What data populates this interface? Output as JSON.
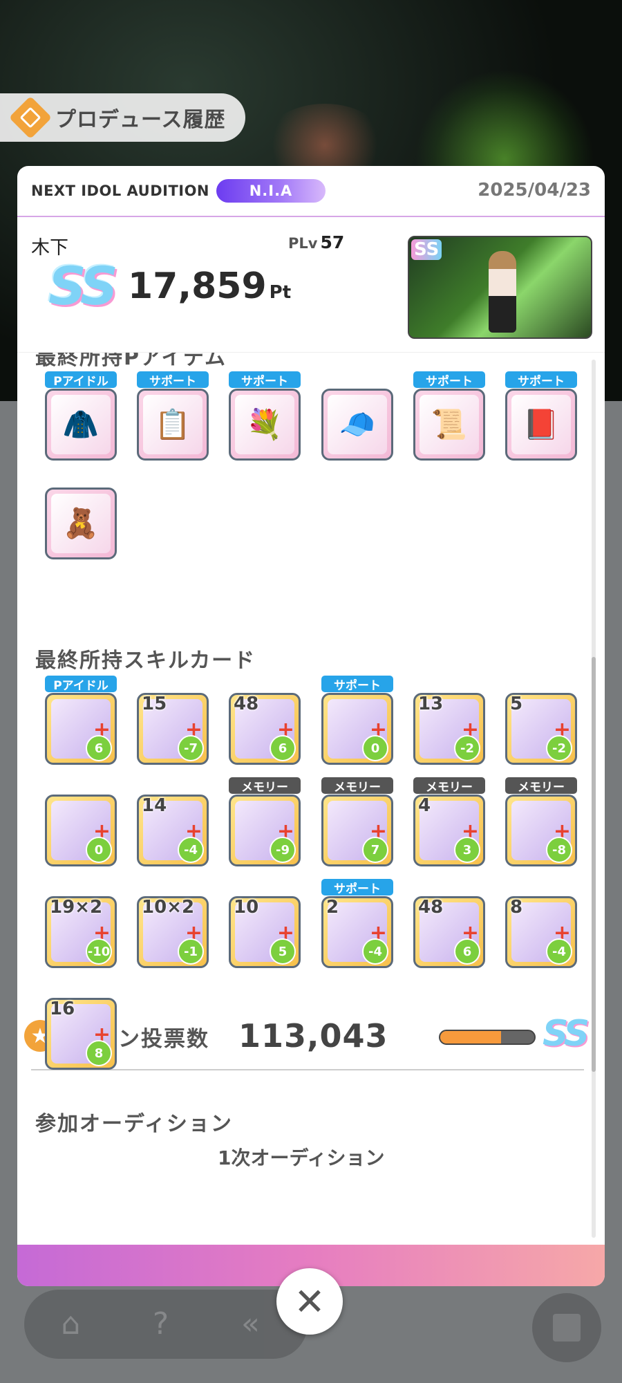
{
  "header": {
    "title": "プロデュース履歴"
  },
  "audition": {
    "label": "NEXT IDOL AUDITION",
    "badge": "N.I.A",
    "date": "2025/04/23"
  },
  "summary": {
    "name": "木下",
    "plv_label": "PLv",
    "plv_value": "57",
    "rank": "SS",
    "score": "17,859",
    "score_unit": "Pt",
    "thumb_rank": "SS"
  },
  "items_section": {
    "title": "最終所持Pアイテム"
  },
  "p_items": [
    {
      "tag": "Pアイドル",
      "icon": "jacket-icon",
      "glyph": "🧥"
    },
    {
      "tag": "サポート",
      "icon": "document-icon",
      "glyph": "📋"
    },
    {
      "tag": "サポート",
      "icon": "flower-card-icon",
      "glyph": "💐"
    },
    {
      "tag": "",
      "icon": "cap-icon",
      "glyph": "🧢"
    },
    {
      "tag": "サポート",
      "icon": "certificate-icon",
      "glyph": "📜"
    },
    {
      "tag": "サポート",
      "icon": "book-icon",
      "glyph": "📕"
    },
    {
      "tag": "",
      "icon": "figure-icon",
      "glyph": "🧸"
    }
  ],
  "skills_section": {
    "title": "最終所持スキルカード"
  },
  "skill_cards": [
    {
      "tag": "Pアイドル",
      "tag_color": "blue",
      "level": "",
      "cost": "6"
    },
    {
      "tag": "",
      "tag_color": "",
      "level": "15",
      "cost": "-7"
    },
    {
      "tag": "",
      "tag_color": "",
      "level": "48",
      "cost": "6"
    },
    {
      "tag": "サポート",
      "tag_color": "blue",
      "level": "",
      "cost": "0"
    },
    {
      "tag": "",
      "tag_color": "",
      "level": "13",
      "cost": "-2"
    },
    {
      "tag": "",
      "tag_color": "",
      "level": "5",
      "cost": "-2"
    },
    {
      "tag": "",
      "tag_color": "",
      "level": "",
      "cost": "0"
    },
    {
      "tag": "",
      "tag_color": "",
      "level": "14",
      "cost": "-4"
    },
    {
      "tag": "メモリー",
      "tag_color": "gray",
      "level": "",
      "cost": "-9"
    },
    {
      "tag": "メモリー",
      "tag_color": "gray",
      "level": "",
      "cost": "7"
    },
    {
      "tag": "メモリー",
      "tag_color": "gray",
      "level": "4",
      "cost": "3"
    },
    {
      "tag": "メモリー",
      "tag_color": "gray",
      "level": "",
      "cost": "-8"
    },
    {
      "tag": "",
      "tag_color": "",
      "level": "19×2",
      "cost": "-10"
    },
    {
      "tag": "",
      "tag_color": "",
      "level": "10×2",
      "cost": "-1"
    },
    {
      "tag": "",
      "tag_color": "",
      "level": "10",
      "cost": "5"
    },
    {
      "tag": "サポート",
      "tag_color": "blue",
      "level": "2",
      "cost": "-4"
    },
    {
      "tag": "",
      "tag_color": "",
      "level": "48",
      "cost": "6"
    },
    {
      "tag": "",
      "tag_color": "",
      "level": "8",
      "cost": "-4"
    },
    {
      "tag": "",
      "tag_color": "",
      "level": "16",
      "cost": "8"
    }
  ],
  "fan_votes": {
    "label": "ファン投票数",
    "value": "113,043",
    "fill": 0.65,
    "rank": "SS"
  },
  "auditions": {
    "title": "参加オーディション",
    "first": "1次オーディション"
  },
  "nav": {
    "close": "✕"
  }
}
